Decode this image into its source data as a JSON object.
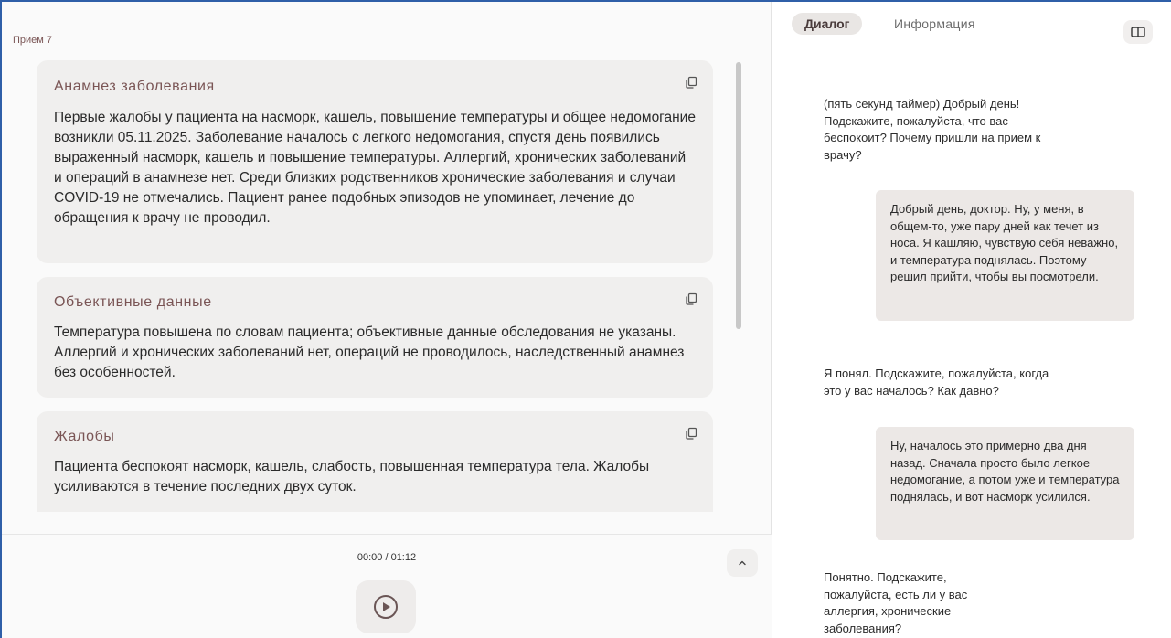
{
  "visit": {
    "title": "Прием 7"
  },
  "sections": [
    {
      "title": "Анамнез заболевания",
      "text": "Первые жалобы у пациента на насморк, кашель, повышение температуры и общее недомогание возникли 05.11.2025. Заболевание началось с легкого недомогания, спустя день появились выраженный насморк, кашель и повышение температуры. Аллергий, хронических заболеваний и операций в анамнезе нет. Среди близких родственников хронические заболевания и случаи COVID-19 не отмечались. Пациент ранее подобных эпизодов не упоминает, лечение до обращения к врачу не проводил.",
      "copy_icon": "copy-icon"
    },
    {
      "title": "Объективные данные",
      "text": "Температура повышена по словам пациента; объективные данные обследования не указаны. Аллергий и хронических заболеваний нет, операций не проводилось, наследственный анамнез без особенностей.",
      "copy_icon": "copy-icon"
    },
    {
      "title": "Жалобы",
      "text": "Пациента беспокоят насморк, кашель, слабость, повышенная температура тела. Жалобы усиливаются в течение последних двух суток.",
      "copy_icon": "copy-icon"
    }
  ],
  "player": {
    "timecode": "00:00 / 01:12",
    "play_icon": "play-circle-icon",
    "collapse_icon": "chevron-up-icon"
  },
  "tabs": {
    "dialog": "Диалог",
    "info": "Информация",
    "panel_icon": "split-panel-icon"
  },
  "dialog": [
    {
      "speaker": "doctor",
      "text": "(пять секунд таймер) Добрый день! Подскажите, пожалуйста, что вас беспокоит? Почему пришли на прием к врачу?"
    },
    {
      "speaker": "patient",
      "text": "Добрый день, доктор. Ну, у меня, в общем-то, уже пару дней как течет из носа. Я кашляю, чувствую себя неважно, и температура поднялась. Поэтому решил прийти, чтобы вы посмотрели."
    },
    {
      "speaker": "doctor",
      "text": "Я понял. Подскажите, пожалуйста, когда это у вас началось? Как давно?"
    },
    {
      "speaker": "patient",
      "text": "Ну, началось это примерно два дня назад. Сначала просто было легкое недомогание, а потом уже и температура поднялась, и вот насморк усилился."
    },
    {
      "speaker": "doctor",
      "text": "Понятно. Подскажите, пожалуйста, есть ли у вас аллергия, хронические заболевания?"
    }
  ],
  "colors": {
    "accent_title": "#7a5555",
    "card_bg": "#f0efee",
    "patient_bubble": "#ece8e6",
    "frame": "#2f5fa8"
  }
}
